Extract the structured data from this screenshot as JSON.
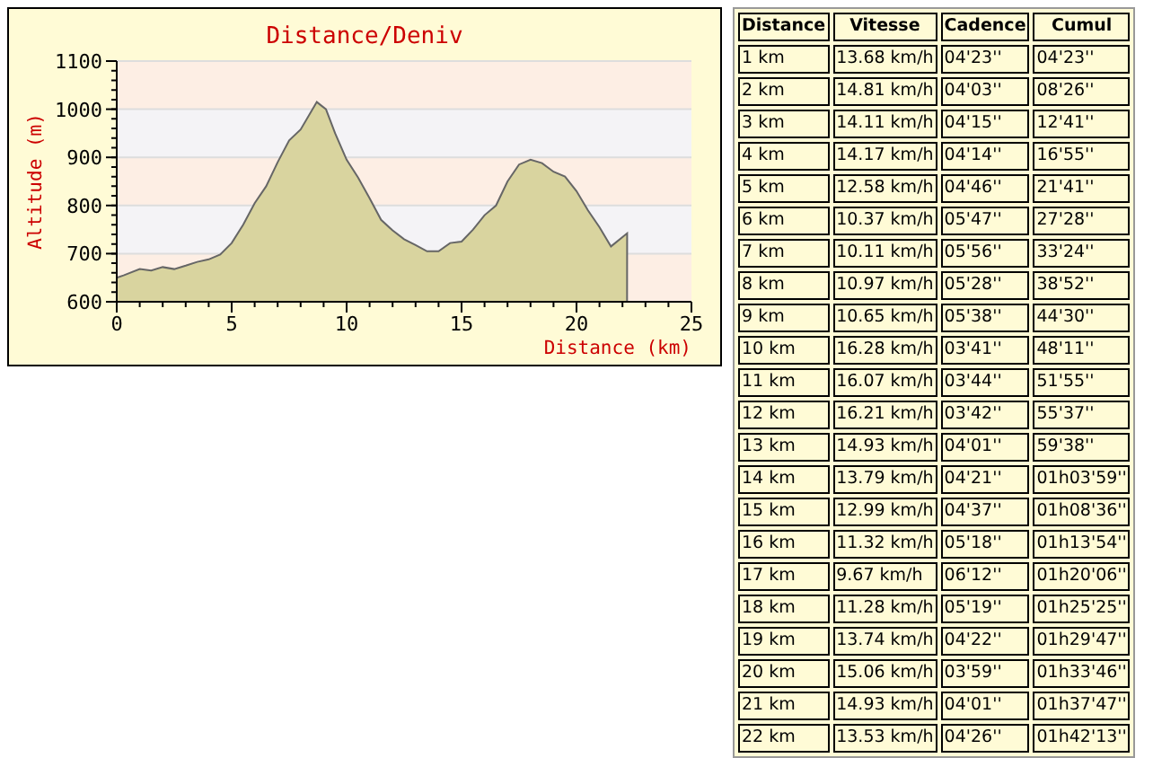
{
  "chart": {
    "chart_data": {
      "type": "area",
      "title": "Distance/Deniv",
      "xlabel": "Distance (km)",
      "ylabel": "Altitude (m)",
      "grid": true,
      "xlim": [
        0,
        25
      ],
      "ylim": [
        600,
        1100
      ],
      "xticks": [
        0,
        5,
        10,
        15,
        20,
        25
      ],
      "yticks": [
        600,
        700,
        800,
        900,
        1000,
        1100
      ],
      "x": [
        0,
        0.3,
        1,
        1.5,
        2,
        2.5,
        3,
        3.5,
        4,
        4.5,
        5,
        5.5,
        6,
        6.5,
        7,
        7.5,
        8,
        8.7,
        9.1,
        9.5,
        10,
        10.5,
        11,
        11.5,
        12,
        12.5,
        13,
        13.5,
        14,
        14.5,
        15,
        15.5,
        16,
        16.5,
        17,
        17.5,
        18,
        18.5,
        19,
        19.5,
        20,
        20.5,
        21,
        21.5,
        22.2
      ],
      "series": [
        {
          "color": "#d9d49f",
          "values": [
            650,
            655,
            668,
            665,
            672,
            668,
            675,
            683,
            688,
            698,
            722,
            760,
            805,
            840,
            890,
            935,
            958,
            1015,
            1000,
            950,
            895,
            858,
            815,
            770,
            748,
            730,
            718,
            705,
            705,
            722,
            725,
            750,
            780,
            800,
            850,
            885,
            895,
            888,
            870,
            860,
            830,
            790,
            755,
            715,
            742
          ]
        }
      ]
    }
  },
  "table": {
    "columns": [
      "Distance",
      "Vitesse",
      "Cadence",
      "Cumul"
    ],
    "rows": [
      [
        "1 km",
        "13.68 km/h",
        "04'23''",
        "04'23''"
      ],
      [
        "2 km",
        "14.81 km/h",
        "04'03''",
        "08'26''"
      ],
      [
        "3 km",
        "14.11 km/h",
        "04'15''",
        "12'41''"
      ],
      [
        "4 km",
        "14.17 km/h",
        "04'14''",
        "16'55''"
      ],
      [
        "5 km",
        "12.58 km/h",
        "04'46''",
        "21'41''"
      ],
      [
        "6 km",
        "10.37 km/h",
        "05'47''",
        "27'28''"
      ],
      [
        "7 km",
        "10.11 km/h",
        "05'56''",
        "33'24''"
      ],
      [
        "8 km",
        "10.97 km/h",
        "05'28''",
        "38'52''"
      ],
      [
        "9 km",
        "10.65 km/h",
        "05'38''",
        "44'30''"
      ],
      [
        "10 km",
        "16.28 km/h",
        "03'41''",
        "48'11''"
      ],
      [
        "11 km",
        "16.07 km/h",
        "03'44''",
        "51'55''"
      ],
      [
        "12 km",
        "16.21 km/h",
        "03'42''",
        "55'37''"
      ],
      [
        "13 km",
        "14.93 km/h",
        "04'01''",
        "59'38''"
      ],
      [
        "14 km",
        "13.79 km/h",
        "04'21''",
        "01h03'59''"
      ],
      [
        "15 km",
        "12.99 km/h",
        "04'37''",
        "01h08'36''"
      ],
      [
        "16 km",
        "11.32 km/h",
        "05'18''",
        "01h13'54''"
      ],
      [
        "17 km",
        "9.67 km/h",
        "06'12''",
        "01h20'06''"
      ],
      [
        "18 km",
        "11.28 km/h",
        "05'19''",
        "01h25'25''"
      ],
      [
        "19 km",
        "13.74 km/h",
        "04'22''",
        "01h29'47''"
      ],
      [
        "20 km",
        "15.06 km/h",
        "03'59''",
        "01h33'46''"
      ],
      [
        "21 km",
        "14.93 km/h",
        "04'01''",
        "01h37'47''"
      ],
      [
        "22 km",
        "13.53 km/h",
        "04'26''",
        "01h42'13''"
      ]
    ]
  }
}
